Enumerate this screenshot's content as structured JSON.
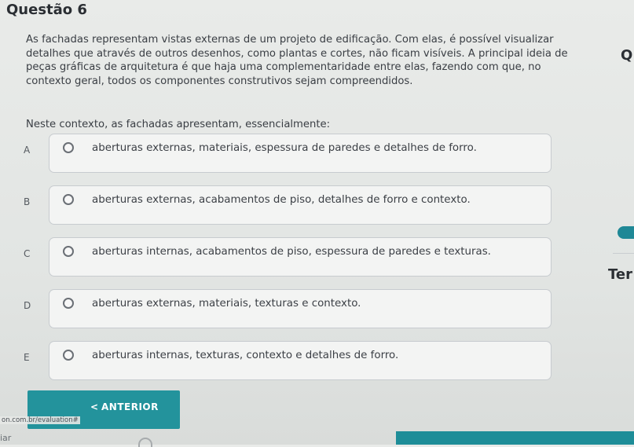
{
  "question": {
    "title": "Questão 6",
    "body": "As fachadas representam vistas externas de um projeto de edificação. Com elas, é possível visualizar detalhes que através de outros desenhos, como plantas e cortes, não ficam visíveis. A principal ideia de peças gráficas de arquitetura é que haja uma complementaridade entre elas, fazendo com que, no contexto geral, todos os componentes construtivos sejam compreendidos.",
    "lead": "Neste contexto, as fachadas apresentam, essencialmente:"
  },
  "options": [
    {
      "letter": "A",
      "text": "aberturas externas, materiais, espessura de paredes e detalhes de forro."
    },
    {
      "letter": "B",
      "text": "aberturas externas, acabamentos de piso, detalhes de forro e contexto."
    },
    {
      "letter": "C",
      "text": "aberturas internas, acabamentos de piso, espessura de paredes e texturas."
    },
    {
      "letter": "D",
      "text": "aberturas externas, materiais, texturas e contexto."
    },
    {
      "letter": "E",
      "text": "aberturas internas, texturas, contexto e detalhes de forro."
    }
  ],
  "nav": {
    "previous_label": "ANTERIOR",
    "previous_chevron": "<"
  },
  "side": {
    "q_label": "Q",
    "ter_label": "Ter"
  },
  "footer": {
    "url_fragment": "on.com.br/evaluation#",
    "bottom_text": "iar"
  },
  "colors": {
    "accent": "#23939c",
    "background": "#e6e8e6",
    "option_border": "#c7cbcf"
  }
}
